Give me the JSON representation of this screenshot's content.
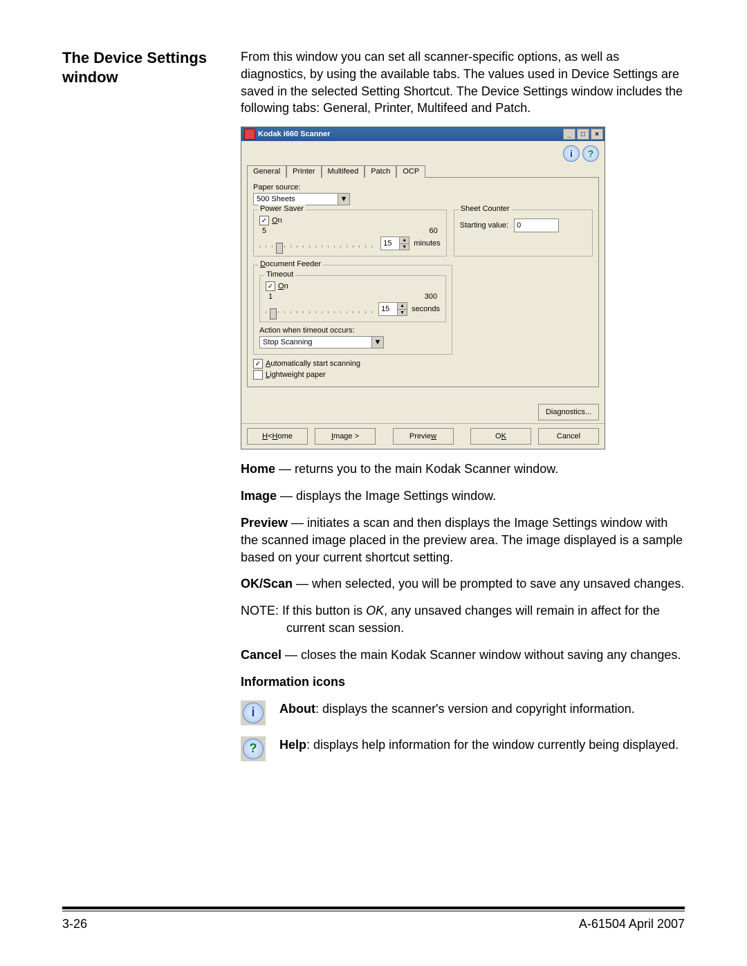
{
  "heading": "The Device Settings window",
  "intro": "From this window you can set all scanner-specific options, as well as diagnostics, by using the available tabs. The values used in Device Settings are saved in the selected Setting Shortcut. The Device Settings window includes the following tabs: General, Printer, Multifeed and Patch.",
  "shot": {
    "title": "Kodak i660 Scanner",
    "tabs": [
      "General",
      "Printer",
      "Multifeed",
      "Patch",
      "OCP"
    ],
    "paper_source_label": "Paper source:",
    "paper_source_value": "500 Sheets",
    "power_saver": {
      "legend": "Power Saver",
      "on_label": "On",
      "min": "5",
      "max": "60",
      "value": "15",
      "unit": "minutes"
    },
    "sheet_counter": {
      "legend": "Sheet Counter",
      "starting_label": "Starting value:",
      "value": "0"
    },
    "doc_feeder": {
      "legend": "Document Feeder",
      "timeout_legend": "Timeout",
      "on_label": "On",
      "min": "1",
      "max": "300",
      "value": "15",
      "unit": "seconds",
      "action_label": "Action when timeout occurs:",
      "action_value": "Stop Scanning"
    },
    "auto_start": "Automatically start scanning",
    "lightweight": "Lightweight paper",
    "diagnostics_btn": "Diagnostics...",
    "buttons": {
      "home": "< Home",
      "image": "Image >",
      "preview": "Preview",
      "ok": "OK",
      "cancel": "Cancel"
    }
  },
  "defs": {
    "home_b": "Home",
    "home_t": " — returns you to the main Kodak Scanner window.",
    "image_b": "Image",
    "image_t": " — displays the Image Settings window.",
    "preview_b": "Preview",
    "preview_t": " — initiates a scan and then displays the Image Settings window with the scanned image placed in the preview area. The image displayed is a sample based on your current shortcut setting.",
    "ok_b": "OK/Scan",
    "ok_t": " — when selected, you will be prompted to save any unsaved changes.",
    "note": "NOTE: If this button is OK, any unsaved changes will remain in affect for the current scan session.",
    "cancel_b": "Cancel",
    "cancel_t": " — closes the main Kodak Scanner window without saving any changes.",
    "info_heading": "Information icons",
    "about_b": "About",
    "about_t": ": displays the scanner's version and copyright information.",
    "help_b": "Help",
    "help_t": ": displays help information for the window currently being displayed."
  },
  "footer": {
    "page": "3-26",
    "doc": "A-61504  April 2007"
  }
}
